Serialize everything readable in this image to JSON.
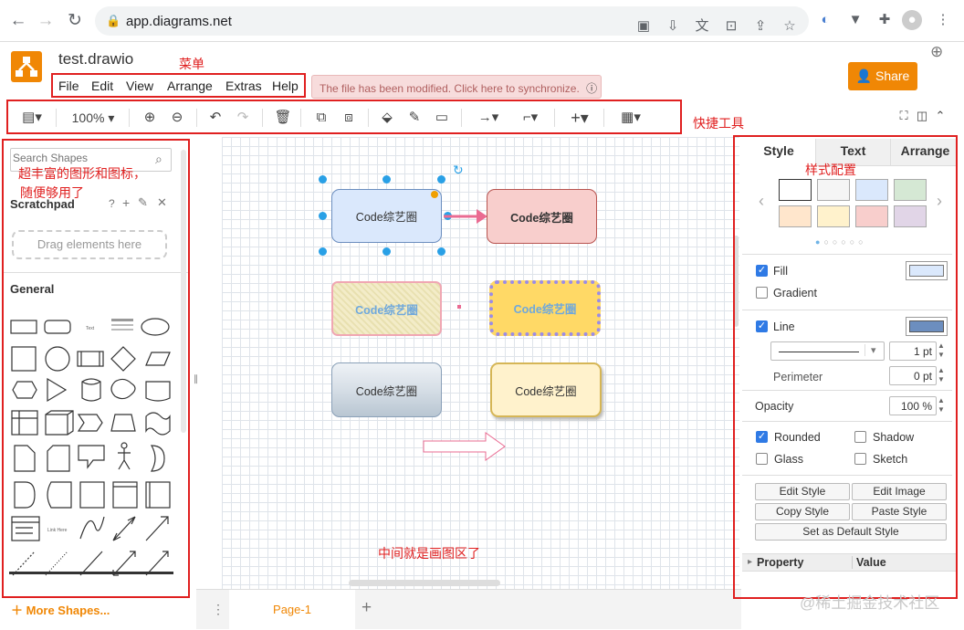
{
  "browser": {
    "url": "app.diagrams.net",
    "back_icon": "arrow-left",
    "forward_icon": "arrow-right",
    "reload_icon": "reload"
  },
  "app": {
    "doc_title": "test.drawio",
    "menu": [
      "File",
      "Edit",
      "View",
      "Arrange",
      "Extras",
      "Help"
    ],
    "sync_banner": "The file has been modified. Click here to synchronize.",
    "share_label": "Share"
  },
  "annotations": {
    "menu": "菜单",
    "toolbar": "快捷工具",
    "shapes_line1": "超丰富的图形和图标，",
    "shapes_line2": "随便够用了",
    "style": "样式配置",
    "canvas": "中间就是画图区了"
  },
  "toolbar": {
    "zoom": "100%"
  },
  "left_panel": {
    "search_placeholder": "Search Shapes",
    "scratchpad_title": "Scratchpad",
    "drag_text": "Drag elements here",
    "general_title": "General",
    "more_shapes": "More Shapes..."
  },
  "canvas": {
    "node_label": "Code综艺圈",
    "colors": {
      "blue_fill": "#dae8fc",
      "blue_stroke": "#6c8ebf",
      "red_fill": "#f8cecc",
      "red_stroke": "#b85450",
      "yellow_fill": "#ffd966",
      "dashed_stroke": "#9673d9",
      "gray_fill": "#c6cfd8",
      "cream_fill": "#fff2cc",
      "cream_stroke": "#d6b656",
      "arrow_pink": "#ea6b92"
    }
  },
  "bottom": {
    "page_tab": "Page-1",
    "add_page": "+"
  },
  "format_panel": {
    "tabs": [
      "Style",
      "Text",
      "Arrange"
    ],
    "swatches": [
      "#ffffff",
      "#f5f5f5",
      "#dae8fc",
      "#d5e8d4",
      "#ffe6cc",
      "#fff2cc",
      "#f8cecc",
      "#e1d5e7"
    ],
    "fill_label": "Fill",
    "fill_color": "#dae8fc",
    "gradient_label": "Gradient",
    "line_label": "Line",
    "line_color": "#6c8ebf",
    "line_width": "1 pt",
    "perimeter_label": "Perimeter",
    "perimeter_value": "0 pt",
    "opacity_label": "Opacity",
    "opacity_value": "100 %",
    "rounded_label": "Rounded",
    "shadow_label": "Shadow",
    "glass_label": "Glass",
    "sketch_label": "Sketch",
    "edit_style": "Edit Style",
    "edit_image": "Edit Image",
    "copy_style": "Copy Style",
    "paste_style": "Paste Style",
    "set_default": "Set as Default Style",
    "property_header": "Property",
    "value_header": "Value"
  },
  "watermark": "@稀土掘金技术社区"
}
